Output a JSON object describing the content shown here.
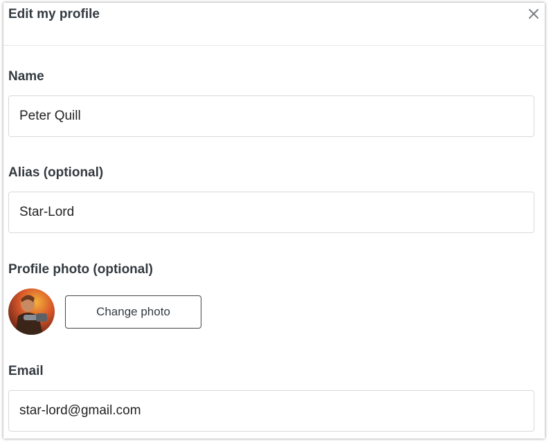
{
  "modal": {
    "title": "Edit my profile"
  },
  "form": {
    "name": {
      "label": "Name",
      "value": "Peter Quill"
    },
    "alias": {
      "label": "Alias (optional)",
      "value": "Star-Lord"
    },
    "photo": {
      "label": "Profile photo (optional)",
      "button_label": "Change photo"
    },
    "email": {
      "label": "Email",
      "value": "star-lord@gmail.com"
    }
  },
  "icons": {
    "close": "close-icon",
    "avatar": "avatar"
  },
  "colors": {
    "text": "#333a40",
    "border": "#d8d8d8",
    "button_border": "#444444"
  }
}
